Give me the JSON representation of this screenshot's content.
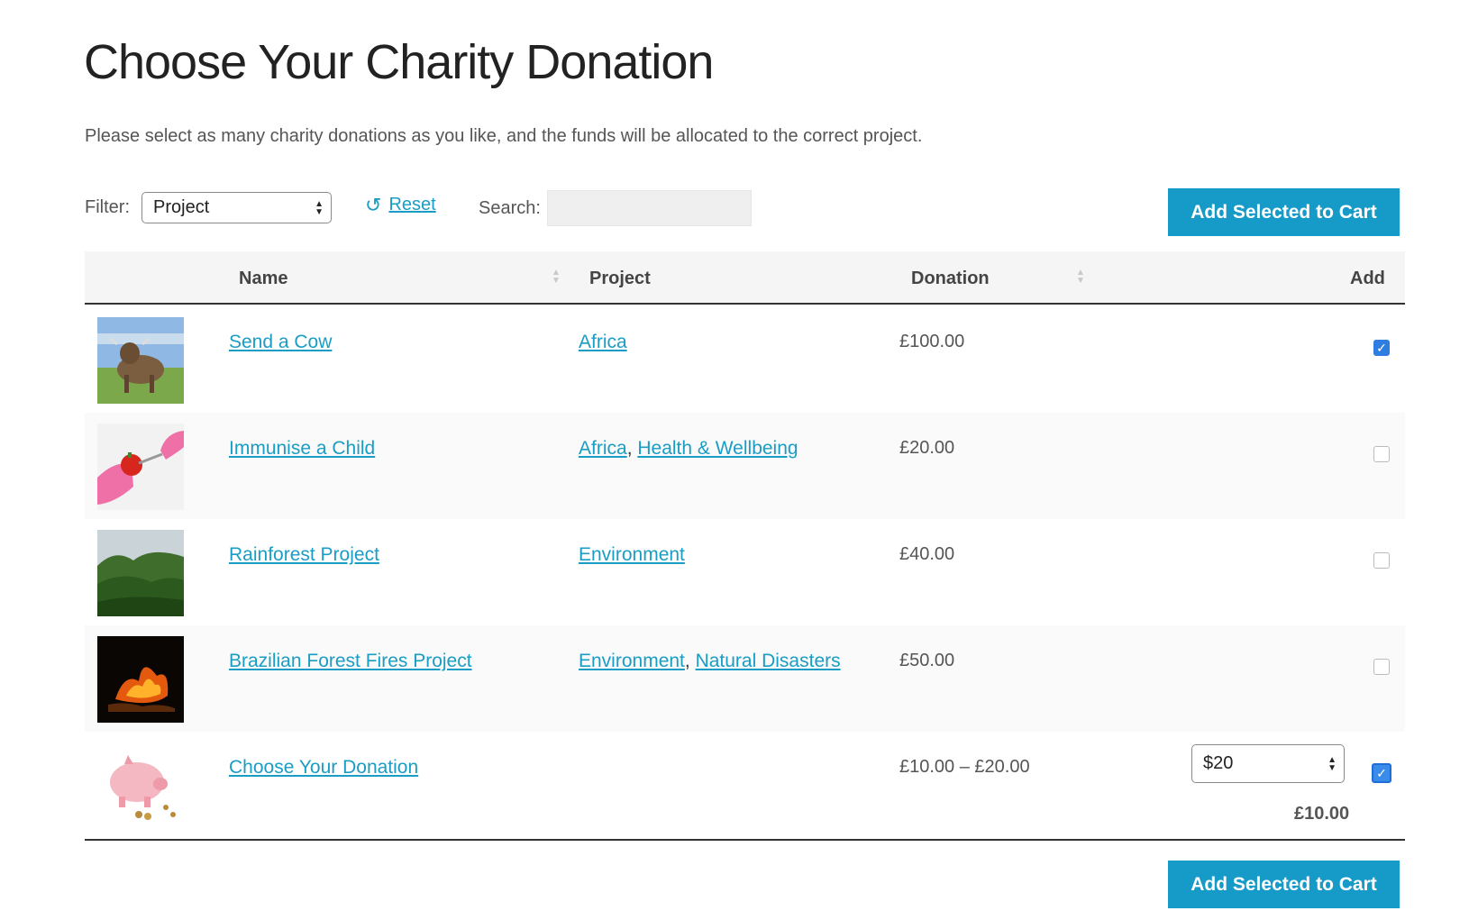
{
  "page": {
    "title": "Choose Your Charity Donation",
    "intro": "Please select as many charity donations as you like, and the funds will be allocated to the correct project."
  },
  "toolbar": {
    "filter_label": "Filter:",
    "filter_value": "Project",
    "reset_label": "Reset",
    "search_label": "Search:",
    "search_value": "",
    "add_to_cart_label": "Add Selected to Cart"
  },
  "table": {
    "columns": {
      "name": "Name",
      "project": "Project",
      "donation": "Donation",
      "add": "Add"
    },
    "rows": [
      {
        "name": "Send a Cow",
        "projects": [
          "Africa"
        ],
        "donation": "£100.00",
        "checked": true,
        "image": "cow-photo"
      },
      {
        "name": "Immunise a Child",
        "projects": [
          "Africa",
          "Health & Wellbeing"
        ],
        "donation": "£20.00",
        "checked": false,
        "image": "injection-photo"
      },
      {
        "name": "Rainforest Project",
        "projects": [
          "Environment"
        ],
        "donation": "£40.00",
        "checked": false,
        "image": "rainforest-photo"
      },
      {
        "name": "Brazilian Forest Fires Project",
        "projects": [
          "Environment",
          "Natural Disasters"
        ],
        "donation": "£50.00",
        "checked": false,
        "image": "fire-photo"
      },
      {
        "name": "Choose Your Donation",
        "projects": [],
        "donation": "£10.00 – £20.00",
        "amount_select_value": "$20",
        "calculated_price": "£10.00",
        "checked": true,
        "image": "piggy-bank-photo"
      }
    ]
  },
  "colors": {
    "accent": "#169ac8",
    "link": "#1a9dc4",
    "checkbox_checked": "#2f7de0"
  }
}
